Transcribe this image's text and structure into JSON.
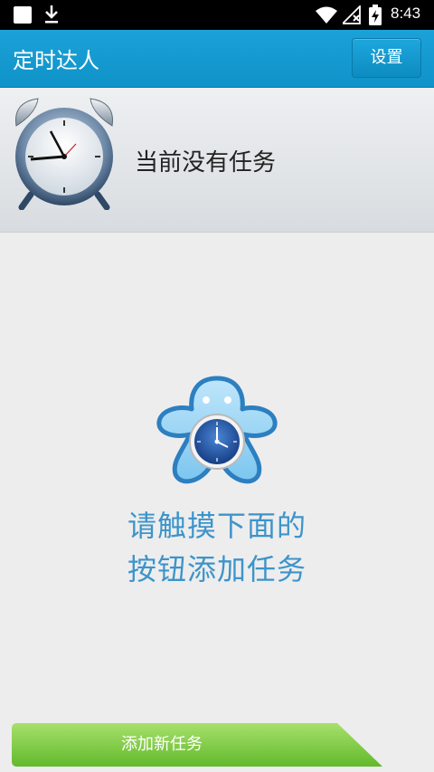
{
  "status_bar": {
    "time": "8:43",
    "icons": [
      "notification-square-icon",
      "download-icon",
      "wifi-icon",
      "no-signal-icon",
      "battery-charging-icon"
    ]
  },
  "app_bar": {
    "title": "定时达人",
    "settings_label": "设置"
  },
  "task_panel": {
    "status_text": "当前没有任务"
  },
  "empty_hint": {
    "line1": "请触摸下面的",
    "line2": "按钮添加任务"
  },
  "add_task_button": {
    "label": "添加新任务"
  },
  "colors": {
    "app_bar": "#1ba2d8",
    "hint_text": "#3d94c9",
    "add_button": "#7ac943"
  }
}
